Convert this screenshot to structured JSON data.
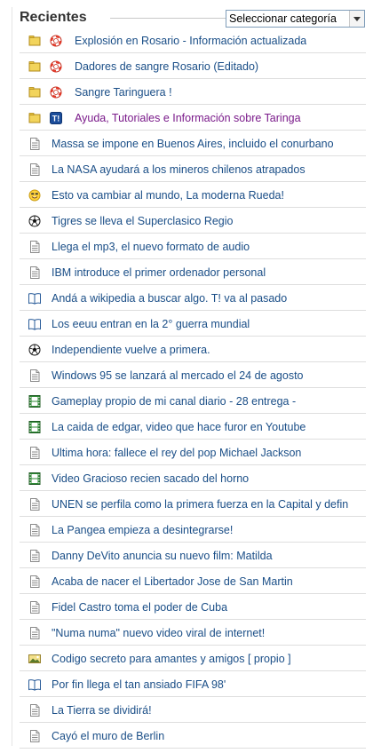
{
  "header": {
    "title": "Recientes",
    "category_select": "Seleccionar categoría"
  },
  "colors": {
    "link": "#1a4e87",
    "link_special": "#7a1a8a",
    "sticky_flag": "#f2d45c"
  },
  "posts": [
    {
      "title": "Explosión en Rosario - Información actualizada",
      "icon": "lifebuoy-icon",
      "sticky": true
    },
    {
      "title": "Dadores de sangre Rosario (Editado)",
      "icon": "lifebuoy-icon",
      "sticky": true
    },
    {
      "title": "Sangre Taringuera !",
      "icon": "lifebuoy-icon",
      "sticky": true
    },
    {
      "title": "Ayuda, Tutoriales e Información sobre Taringa",
      "icon": "taringa-icon",
      "sticky": true,
      "special": true
    },
    {
      "title": "Massa se impone en Buenos Aires, incluido el conurbano",
      "icon": "document-icon"
    },
    {
      "title": "La NASA ayudará a los mineros chilenos atrapados",
      "icon": "document-icon"
    },
    {
      "title": "Esto va cambiar al mundo, La moderna Rueda!",
      "icon": "smiley-icon"
    },
    {
      "title": "Tigres se lleva el Superclasico Regio",
      "icon": "soccer-ball-icon"
    },
    {
      "title": "Llega el mp3, el nuevo formato de audio",
      "icon": "document-icon"
    },
    {
      "title": "IBM introduce el primer ordenador personal",
      "icon": "document-icon"
    },
    {
      "title": "Andá a wikipedia a buscar algo. T! va al pasado",
      "icon": "book-icon"
    },
    {
      "title": "Los eeuu entran en la 2° guerra mundial",
      "icon": "book-icon"
    },
    {
      "title": "Independiente vuelve a primera.",
      "icon": "soccer-ball-icon"
    },
    {
      "title": "Windows 95 se lanzará al mercado el 24 de agosto",
      "icon": "document-icon"
    },
    {
      "title": "Gameplay propio de mi canal diario - 28 entrega -",
      "icon": "film-icon"
    },
    {
      "title": "La caida de edgar, video que hace furor en Youtube",
      "icon": "film-icon"
    },
    {
      "title": "Ultima hora: fallece el rey del pop Michael Jackson",
      "icon": "document-icon"
    },
    {
      "title": "Video Gracioso recien sacado del horno",
      "icon": "film-icon"
    },
    {
      "title": "UNEN se perfila como la primera fuerza en la Capital y defin",
      "icon": "document-icon"
    },
    {
      "title": "La Pangea empieza a desintegrarse!",
      "icon": "document-icon"
    },
    {
      "title": "Danny DeVito anuncia su nuevo film: Matilda",
      "icon": "document-icon"
    },
    {
      "title": "Acaba de nacer el Libertador Jose de San Martin",
      "icon": "document-icon"
    },
    {
      "title": "Fidel Castro toma el poder de Cuba",
      "icon": "document-icon"
    },
    {
      "title": "\"Numa numa\" nuevo video viral de internet!",
      "icon": "document-icon"
    },
    {
      "title": "Codigo secreto para amantes y amigos [ propio ]",
      "icon": "image-icon"
    },
    {
      "title": "Por fin llega el tan ansiado FIFA 98'",
      "icon": "book-icon"
    },
    {
      "title": "La Tierra se dividirá!",
      "icon": "document-icon"
    },
    {
      "title": "Cayó el muro de Berlin",
      "icon": "document-icon"
    }
  ]
}
